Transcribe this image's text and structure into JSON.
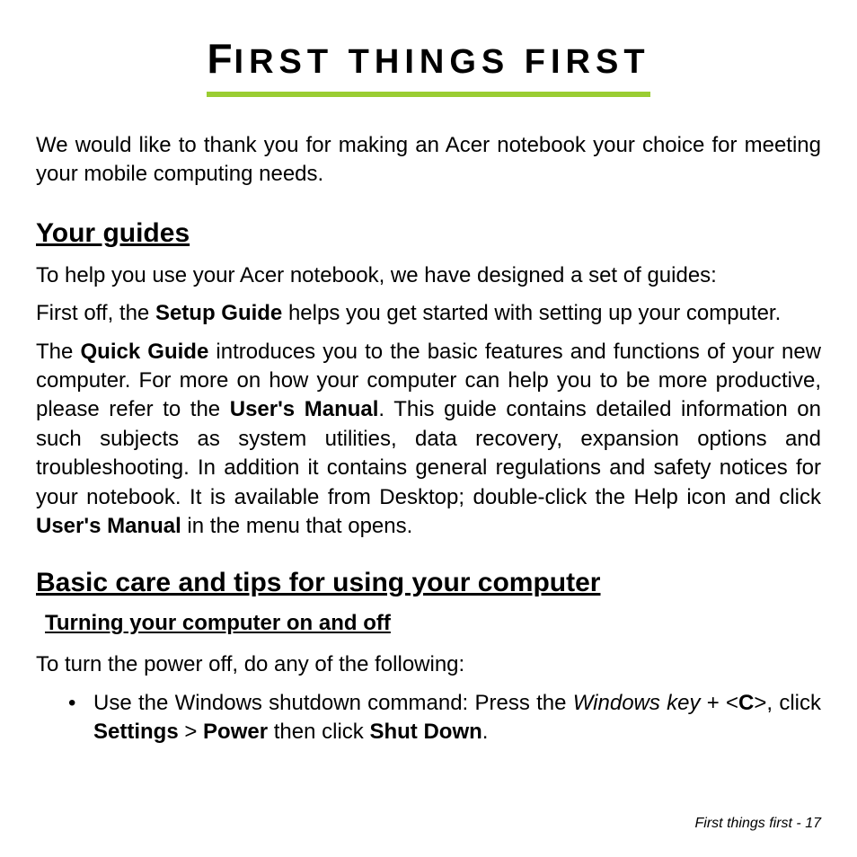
{
  "title": {
    "f": "F",
    "rest": "IRST THINGS FIRST"
  },
  "intro": "We would like to thank you for making an Acer notebook your choice for meeting your mobile computing needs.",
  "guides": {
    "heading": "Your guides",
    "p1": "To help you use your Acer notebook, we have designed a set of guides:",
    "p2_a": "First off, the ",
    "p2_b": "Setup Guide",
    "p2_c": " helps you get started with setting up your computer.",
    "p3_a": "The ",
    "p3_b": "Quick Guide",
    "p3_c": " introduces you to the basic features and functions of your new computer. For more on how your computer can help you to be more productive, please refer to the ",
    "p3_d": "User's Manual",
    "p3_e": ". This guide contains detailed information on such subjects as system utilities, data recovery, expansion options and troubleshooting. In addition it contains general regulations and safety notices for your notebook. It is available from Desktop; double-click the Help icon and click ",
    "p3_f": "User's Manual",
    "p3_g": " in the menu that opens."
  },
  "care": {
    "heading": "Basic care and tips for using your computer",
    "sub": "Turning your computer on and off",
    "p1": "To turn the power off, do any of the following:",
    "li_a": "Use the Windows shutdown command: Press the ",
    "li_b": "Windows key",
    "li_c": " + <",
    "li_d": "C",
    "li_e": ">, click ",
    "li_f": "Settings",
    "li_g": " > ",
    "li_h": "Power",
    "li_i": " then click ",
    "li_j": "Shut Down",
    "li_k": "."
  },
  "footer": "First things first -  17"
}
